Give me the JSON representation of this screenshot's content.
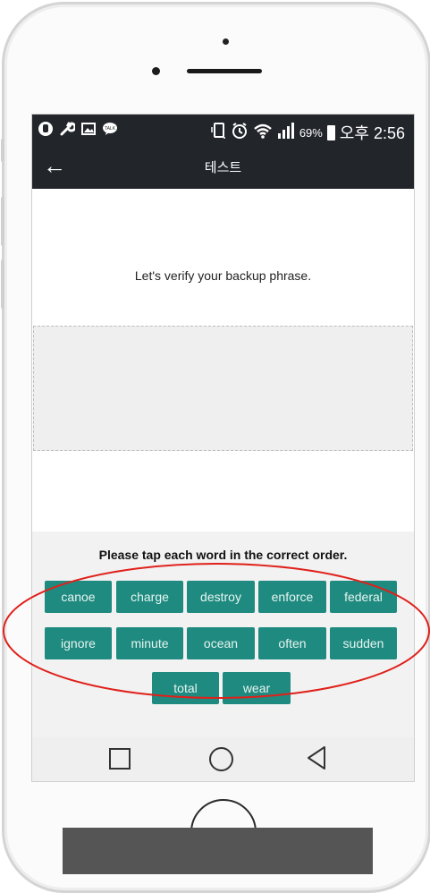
{
  "status_bar": {
    "battery_percent": "69%",
    "time": "오후 2:56",
    "icons_left": [
      "app-icon",
      "wrench-icon",
      "image-icon",
      "talk-icon"
    ],
    "icons_right": [
      "vibrate-icon",
      "alarm-icon",
      "wifi-icon",
      "signal-icon",
      "battery-icon"
    ]
  },
  "app_bar": {
    "back_icon": "←",
    "title": "테스트"
  },
  "main": {
    "verify_text": "Let's verify your backup phrase."
  },
  "word_panel": {
    "instruction": "Please tap each word in the correct order.",
    "words": [
      "canoe",
      "charge",
      "destroy",
      "enforce",
      "federal",
      "ignore",
      "minute",
      "ocean",
      "often",
      "sudden",
      "total",
      "wear"
    ]
  },
  "nav_bar": {
    "icons": [
      "recent-apps-icon",
      "home-icon",
      "back-icon"
    ]
  },
  "colors": {
    "word_button": "#1f8a7f",
    "app_bar": "#22262b",
    "highlight": "#e0201a"
  }
}
